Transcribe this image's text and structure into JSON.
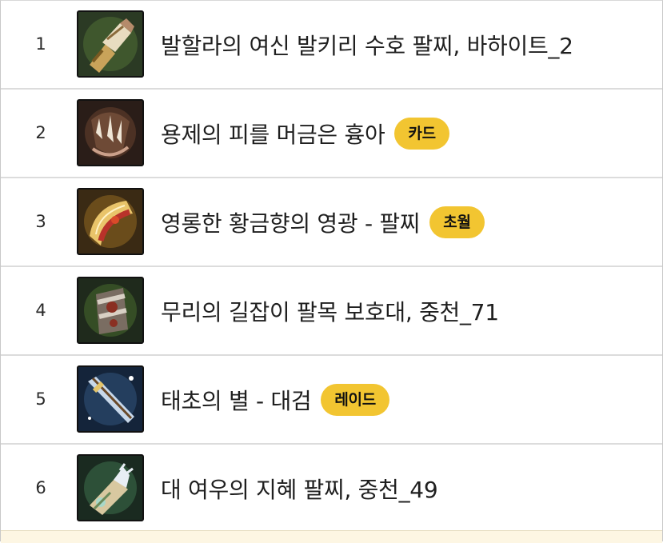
{
  "items": [
    {
      "rank": "1",
      "name": "발할라의 여신 발키리 수호 팔찌, 바하이트_2",
      "badge": "",
      "icon": "gauntlet-icon"
    },
    {
      "rank": "2",
      "name": "용제의 피를 머금은 흉아",
      "badge": "카드",
      "icon": "dragon-fang-icon"
    },
    {
      "rank": "3",
      "name": "영롱한 황금향의 영광 - 팔찌",
      "badge": "초월",
      "icon": "golden-bracelet-icon"
    },
    {
      "rank": "4",
      "name": "무리의 길잡이 팔목 보호대, 중천_71",
      "badge": "",
      "icon": "wrist-guard-icon"
    },
    {
      "rank": "5",
      "name": "태초의 별 - 대검",
      "badge": "레이드",
      "icon": "greatsword-icon"
    },
    {
      "rank": "6",
      "name": "대 여우의 지혜 팔찌, 중천_49",
      "badge": "",
      "icon": "fox-bracelet-icon"
    }
  ],
  "colors": {
    "badge": "#f2c531",
    "divider": "#dcdcdc",
    "text": "#1f1f1f"
  }
}
